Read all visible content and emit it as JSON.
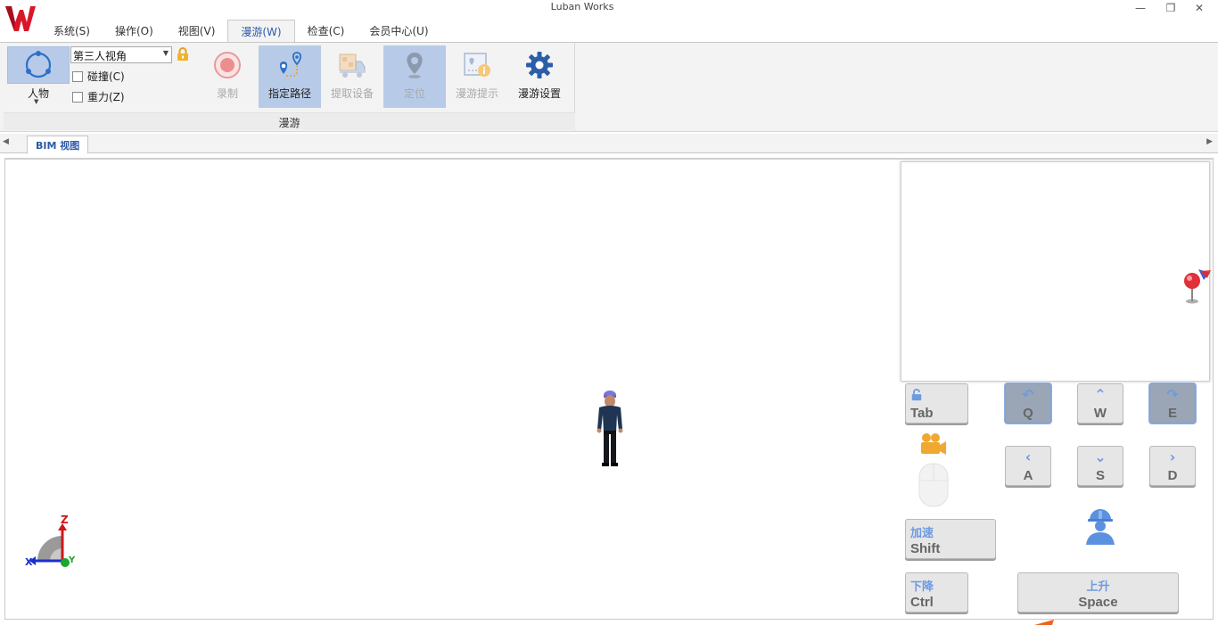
{
  "window": {
    "title": "Luban Works",
    "logo_letter": "W"
  },
  "menu": {
    "tabs": [
      {
        "label": "系统(S)"
      },
      {
        "label": "操作(O)"
      },
      {
        "label": "视图(V)"
      },
      {
        "label": "漫游(W)",
        "active": true
      },
      {
        "label": "检查(C)"
      },
      {
        "label": "会员中心(U)"
      }
    ]
  },
  "ribbon": {
    "group_label": "漫游",
    "person": {
      "label": "人物",
      "icon": "person-orbit-icon"
    },
    "view_mode": {
      "value": "第三人视角"
    },
    "collision": {
      "label": "碰撞(C)",
      "checked": false
    },
    "gravity": {
      "label": "重力(Z)",
      "checked": false
    },
    "buttons": [
      {
        "label": "录制",
        "icon": "record-icon",
        "enabled": false
      },
      {
        "label": "指定路径",
        "icon": "route-pin-icon",
        "selected": true
      },
      {
        "label": "提取设备",
        "icon": "truck-icon",
        "enabled": false
      },
      {
        "label": "定位",
        "icon": "location-pin-icon",
        "selected": true,
        "enabled": false
      },
      {
        "label": "漫游提示",
        "icon": "map-info-icon",
        "enabled": false
      },
      {
        "label": "漫游设置",
        "icon": "gear-icon",
        "enabled": true
      }
    ]
  },
  "document": {
    "tab_label": "BIM 视图"
  },
  "axis": {
    "z": "Z",
    "x": "X",
    "y": "Y"
  },
  "keys": {
    "tab": "Tab",
    "q": "Q",
    "w": "W",
    "e": "E",
    "a": "A",
    "s": "S",
    "d": "D",
    "shift": "Shift",
    "shift_hint": "加速",
    "ctrl": "Ctrl",
    "ctrl_hint": "下降",
    "space": "Space",
    "space_hint": "上升"
  },
  "colors": {
    "accent": "#2b5aa8",
    "selected_bg": "#b7cbe8",
    "key_hint": "#6e9ae0"
  }
}
